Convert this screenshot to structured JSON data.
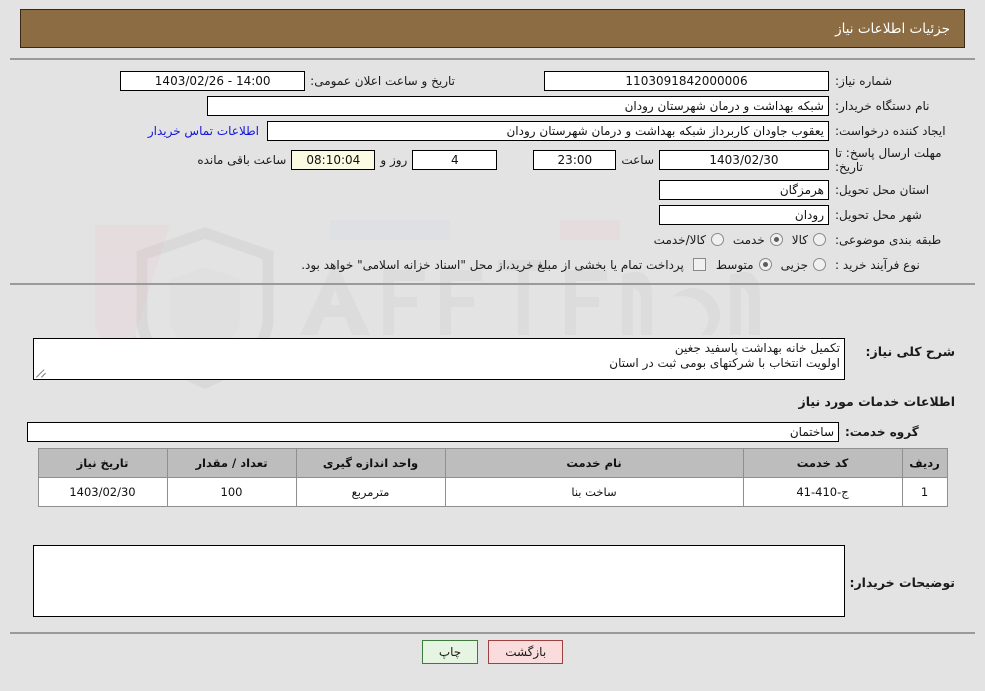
{
  "header": {
    "title": "جزئیات اطلاعات نیاز"
  },
  "colors": {
    "header_bg": "#8c6c42",
    "page_bg": "#e3e3e3",
    "link": "#1414e0",
    "timer_bg": "#fbfbe4",
    "table_header_bg": "#bdbdbd",
    "back_button_bg": "#fbdcdc",
    "print_button_bg": "#e6f5e2"
  },
  "fields": {
    "need_number_label": "شماره نیاز:",
    "need_number_value": "1103091842000006",
    "public_announce_label": "تاریخ و ساعت اعلان عمومی:",
    "public_announce_value": "14:00 - 1403/02/26",
    "buyer_org_label": "نام دستگاه خریدار:",
    "buyer_org_value": "شبکه بهداشت و درمان شهرستان رودان",
    "requester_label": "ایجاد کننده درخواست:",
    "requester_value": "یعقوب جاودان کاربرداز شبکه بهداشت و درمان شهرستان رودان",
    "contact_link": "اطلاعات تماس خریدار",
    "deadline_label": "مهلت ارسال پاسخ: تا تاریخ:",
    "deadline_date": "1403/02/30",
    "hour_label": "ساعت",
    "deadline_time": "23:00",
    "remaining_days": "4",
    "days_and_label": "روز و",
    "remaining_time": "08:10:04",
    "remaining_suffix": "ساعت باقی مانده",
    "province_label": "استان محل تحویل:",
    "province_value": "هرمزگان",
    "city_label": "شهر محل تحویل:",
    "city_value": "رودان",
    "category_label": "طبقه بندی موضوعی:",
    "process_type_label": "نوع فرآیند خرید :",
    "treasury_note": "پرداخت تمام یا بخشی از مبلغ خرید،از محل \"اسناد خزانه اسلامی\" خواهد بود.",
    "general_desc_label": "شرح کلی نیاز:",
    "general_desc_line1": "تکمیل خانه بهداشت پاسفید جغین",
    "general_desc_line2": "اولویت انتخاب با شرکتهای بومی ثبت در استان",
    "services_section_title": "اطلاعات خدمات مورد نیاز",
    "service_group_label": "گروه خدمت:",
    "service_group_value": "ساختمان",
    "buyer_comments_label": "توضیحات خریدار:",
    "buyer_comments_value": ""
  },
  "category_options": [
    {
      "label": "کالا",
      "selected": false
    },
    {
      "label": "خدمت",
      "selected": true
    },
    {
      "label": "کالا/خدمت",
      "selected": false
    }
  ],
  "process_options": [
    {
      "label": "جزیی",
      "selected": false
    },
    {
      "label": "متوسط",
      "selected": true
    }
  ],
  "treasury_checkbox_checked": false,
  "table": {
    "headers": [
      "ردیف",
      "کد خدمت",
      "نام خدمت",
      "واحد اندازه گیری",
      "تعداد / مقدار",
      "تاریخ نیاز"
    ],
    "rows": [
      [
        "1",
        "ج-410-41",
        "ساخت بنا",
        "مترمربع",
        "100",
        "1403/02/30"
      ]
    ]
  },
  "footer": {
    "back_label": "بازگشت",
    "print_label": "چاپ"
  },
  "watermark": {
    "text": "AnaTender.net"
  }
}
